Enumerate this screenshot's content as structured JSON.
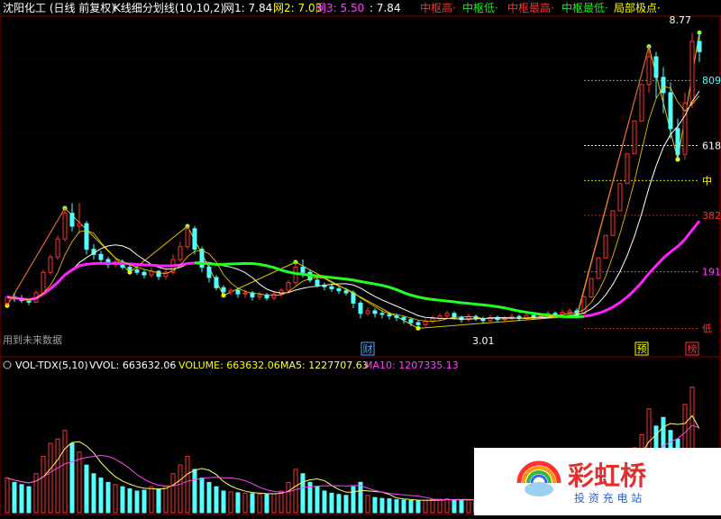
{
  "header": {
    "title": "沈阳化工 (日线 前复权)",
    "indicator": "K线细分划线(10,10,2)",
    "items": [
      {
        "label": "网1: 7.84",
        "color": "#ffffff"
      },
      {
        "label": "网2: 7.03",
        "color": "#ffff00"
      },
      {
        "label": "网3: 5.50",
        "color": "#ff44ff"
      },
      {
        "label": ": 7.84",
        "color": "#ffffff"
      },
      {
        "label": "中枢高·",
        "color": "#ff3030"
      },
      {
        "label": "中枢低·",
        "color": "#00ff00"
      },
      {
        "label": "中枢最高·",
        "color": "#ff3030"
      },
      {
        "label": "中枢最低·",
        "color": "#00ff00"
      },
      {
        "label": "局部极点·",
        "color": "#ffff00"
      }
    ]
  },
  "future_data_label": "用到未来数据",
  "vol_header": {
    "name": "VOL-TDX(5,10)",
    "vvol": "VVOL: 663632.06",
    "volume": "VOLUME: 663632.06",
    "ma5": "MA5: 1227707.63",
    "ma10": "MA10: 1207335.13"
  },
  "watermark": {
    "line1": "彩虹桥",
    "line2": "投 资 充 电 站"
  },
  "colors": {
    "up": "#ff3232",
    "down": "#54ffff",
    "ma_green": "#22ff22",
    "ma_pink": "#ff22ff",
    "ma_white": "#ffffff",
    "fib": "#ffff00",
    "vol_ma5": "#ffff66",
    "vol_ma10": "#ff44ff"
  },
  "chart_data": {
    "type": "candlestick",
    "price_labels": {
      "high": "8.77",
      "low": "3.01"
    },
    "price_range": [
      2.7,
      8.95
    ],
    "fib_levels": [
      {
        "label": "809",
        "value": 7.84,
        "color": "#54ffff"
      },
      {
        "label": "618",
        "value": 6.57,
        "color": "#ffffff"
      },
      {
        "label": "中",
        "value": 5.89,
        "color": "#ffff00"
      },
      {
        "label": "382",
        "value": 5.21,
        "color": "#ff3232"
      },
      {
        "label": "191",
        "value": 4.11,
        "color": "#ff44ff"
      },
      {
        "label": "低",
        "value": 3.01,
        "color": "#ff3232"
      }
    ],
    "markers": [
      {
        "text": "财",
        "index": 50,
        "color": "#54a8ff"
      },
      {
        "text": "预",
        "index": 88,
        "color": "#ffff00"
      },
      {
        "text": "榜",
        "index": 95,
        "color": "#ff3232"
      }
    ],
    "candles": [
      [
        3.5,
        3.62,
        3.65,
        3.45
      ],
      [
        3.62,
        3.58,
        3.7,
        3.52
      ],
      [
        3.58,
        3.55,
        3.66,
        3.5
      ],
      [
        3.55,
        3.52,
        3.6,
        3.46
      ],
      [
        3.52,
        3.7,
        3.75,
        3.5
      ],
      [
        3.7,
        4.1,
        4.15,
        3.68
      ],
      [
        4.1,
        4.4,
        4.45,
        4.05
      ],
      [
        4.4,
        4.75,
        4.82,
        4.35
      ],
      [
        4.75,
        5.25,
        5.35,
        4.7
      ],
      [
        5.25,
        5.0,
        5.45,
        4.9
      ],
      [
        5.0,
        5.05,
        5.45,
        4.85
      ],
      [
        5.05,
        4.55,
        5.1,
        4.45
      ],
      [
        4.55,
        4.45,
        4.65,
        4.35
      ],
      [
        4.45,
        4.35,
        4.52,
        4.25
      ],
      [
        4.35,
        4.25,
        4.4,
        4.18
      ],
      [
        4.25,
        4.3,
        4.36,
        4.2
      ],
      [
        4.3,
        4.2,
        4.35,
        4.15
      ],
      [
        4.2,
        4.15,
        4.25,
        4.1
      ],
      [
        4.15,
        4.1,
        4.2,
        4.05
      ],
      [
        4.1,
        4.05,
        4.15,
        3.98
      ],
      [
        4.05,
        4.12,
        4.2,
        4.0
      ],
      [
        4.12,
        4.02,
        4.15,
        3.95
      ],
      [
        4.02,
        4.1,
        4.18,
        3.96
      ],
      [
        4.1,
        4.35,
        4.45,
        4.05
      ],
      [
        4.35,
        4.6,
        4.7,
        4.3
      ],
      [
        4.6,
        4.95,
        5.0,
        4.55
      ],
      [
        4.95,
        4.55,
        5.0,
        4.45
      ],
      [
        4.55,
        4.2,
        4.6,
        4.1
      ],
      [
        4.2,
        4.0,
        4.25,
        3.9
      ],
      [
        4.0,
        3.8,
        4.05,
        3.75
      ],
      [
        3.8,
        3.72,
        3.85,
        3.65
      ],
      [
        3.72,
        3.75,
        3.8,
        3.66
      ],
      [
        3.75,
        3.68,
        3.8,
        3.6
      ],
      [
        3.68,
        3.7,
        3.76,
        3.6
      ],
      [
        3.7,
        3.62,
        3.74,
        3.55
      ],
      [
        3.62,
        3.66,
        3.72,
        3.56
      ],
      [
        3.66,
        3.6,
        3.7,
        3.55
      ],
      [
        3.6,
        3.68,
        3.74,
        3.56
      ],
      [
        3.68,
        3.75,
        3.8,
        3.62
      ],
      [
        3.75,
        3.9,
        3.95,
        3.7
      ],
      [
        3.9,
        4.2,
        4.3,
        3.85
      ],
      [
        4.2,
        4.1,
        4.35,
        4.0
      ],
      [
        4.1,
        3.95,
        4.15,
        3.9
      ],
      [
        3.95,
        3.85,
        4.0,
        3.8
      ],
      [
        3.85,
        3.82,
        3.9,
        3.75
      ],
      [
        3.82,
        3.78,
        3.88,
        3.72
      ],
      [
        3.78,
        3.74,
        3.82,
        3.68
      ],
      [
        3.74,
        3.7,
        3.8,
        3.65
      ],
      [
        3.7,
        3.5,
        3.75,
        3.4
      ],
      [
        3.5,
        3.3,
        3.55,
        3.2
      ],
      [
        3.3,
        3.35,
        3.42,
        3.25
      ],
      [
        3.35,
        3.3,
        3.4,
        3.22
      ],
      [
        3.3,
        3.28,
        3.36,
        3.2
      ],
      [
        3.28,
        3.25,
        3.32,
        3.18
      ],
      [
        3.25,
        3.22,
        3.3,
        3.15
      ],
      [
        3.22,
        3.18,
        3.26,
        3.1
      ],
      [
        3.18,
        3.12,
        3.22,
        3.05
      ],
      [
        3.12,
        3.08,
        3.16,
        3.01
      ],
      [
        3.08,
        3.15,
        3.2,
        3.05
      ],
      [
        3.15,
        3.2,
        3.26,
        3.1
      ],
      [
        3.2,
        3.25,
        3.3,
        3.15
      ],
      [
        3.25,
        3.3,
        3.35,
        3.2
      ],
      [
        3.3,
        3.22,
        3.34,
        3.18
      ],
      [
        3.22,
        3.18,
        3.26,
        3.12
      ],
      [
        3.18,
        3.24,
        3.3,
        3.14
      ],
      [
        3.24,
        3.2,
        3.28,
        3.15
      ],
      [
        3.2,
        3.16,
        3.24,
        3.1
      ],
      [
        3.16,
        3.22,
        3.28,
        3.12
      ],
      [
        3.22,
        3.18,
        3.26,
        3.14
      ],
      [
        3.18,
        3.2,
        3.25,
        3.12
      ],
      [
        3.2,
        3.24,
        3.3,
        3.16
      ],
      [
        3.24,
        3.2,
        3.28,
        3.15
      ],
      [
        3.2,
        3.26,
        3.32,
        3.16
      ],
      [
        3.26,
        3.22,
        3.3,
        3.18
      ],
      [
        3.22,
        3.25,
        3.3,
        3.18
      ],
      [
        3.25,
        3.3,
        3.35,
        3.2
      ],
      [
        3.3,
        3.28,
        3.34,
        3.22
      ],
      [
        3.28,
        3.32,
        3.38,
        3.24
      ],
      [
        3.32,
        3.35,
        3.4,
        3.28
      ],
      [
        3.35,
        3.3,
        3.4,
        3.25
      ],
      [
        3.3,
        3.62,
        3.65,
        3.28
      ],
      [
        3.62,
        3.98,
        3.98,
        3.6
      ],
      [
        3.98,
        4.38,
        4.38,
        3.98
      ],
      [
        4.38,
        4.82,
        4.82,
        4.38
      ],
      [
        4.82,
        5.3,
        5.3,
        4.82
      ],
      [
        5.3,
        5.83,
        5.83,
        5.3
      ],
      [
        5.83,
        6.41,
        6.41,
        5.83
      ],
      [
        6.41,
        7.05,
        7.05,
        6.41
      ],
      [
        7.05,
        7.76,
        7.76,
        7.05
      ],
      [
        7.76,
        8.3,
        8.5,
        7.6
      ],
      [
        8.3,
        7.9,
        8.4,
        7.5
      ],
      [
        7.9,
        7.6,
        8.1,
        7.2
      ],
      [
        7.6,
        6.9,
        7.8,
        6.7
      ],
      [
        6.9,
        6.4,
        7.1,
        6.3
      ],
      [
        6.4,
        7.4,
        7.6,
        6.3
      ],
      [
        7.4,
        8.6,
        8.77,
        7.3
      ],
      [
        8.6,
        8.4,
        8.77,
        8.2
      ]
    ],
    "volume_range": [
      0,
      3100000
    ],
    "volume": [
      800000,
      700000,
      650000,
      600000,
      900000,
      1300000,
      1600000,
      1700000,
      1900000,
      1600000,
      1400000,
      1100000,
      900000,
      800000,
      700000,
      650000,
      600000,
      550000,
      500000,
      520000,
      600000,
      550000,
      620000,
      900000,
      1100000,
      1300000,
      1000000,
      800000,
      700000,
      600000,
      500000,
      480000,
      460000,
      450000,
      440000,
      430000,
      420000,
      440000,
      500000,
      700000,
      1000000,
      900000,
      700000,
      600000,
      500000,
      450000,
      420000,
      400000,
      600000,
      700000,
      400000,
      350000,
      330000,
      320000,
      300000,
      290000,
      280000,
      270000,
      290000,
      300000,
      310000,
      320000,
      300000,
      290000,
      300000,
      280000,
      270000,
      290000,
      280000,
      290000,
      300000,
      290000,
      310000,
      300000,
      310000,
      320000,
      310000,
      330000,
      340000,
      330000,
      600000,
      800000,
      900000,
      1000000,
      1100000,
      1200000,
      1300000,
      1500000,
      1800000,
      2400000,
      2000000,
      2200000,
      1900000,
      1700000,
      2500000,
      2900000,
      700000
    ]
  }
}
